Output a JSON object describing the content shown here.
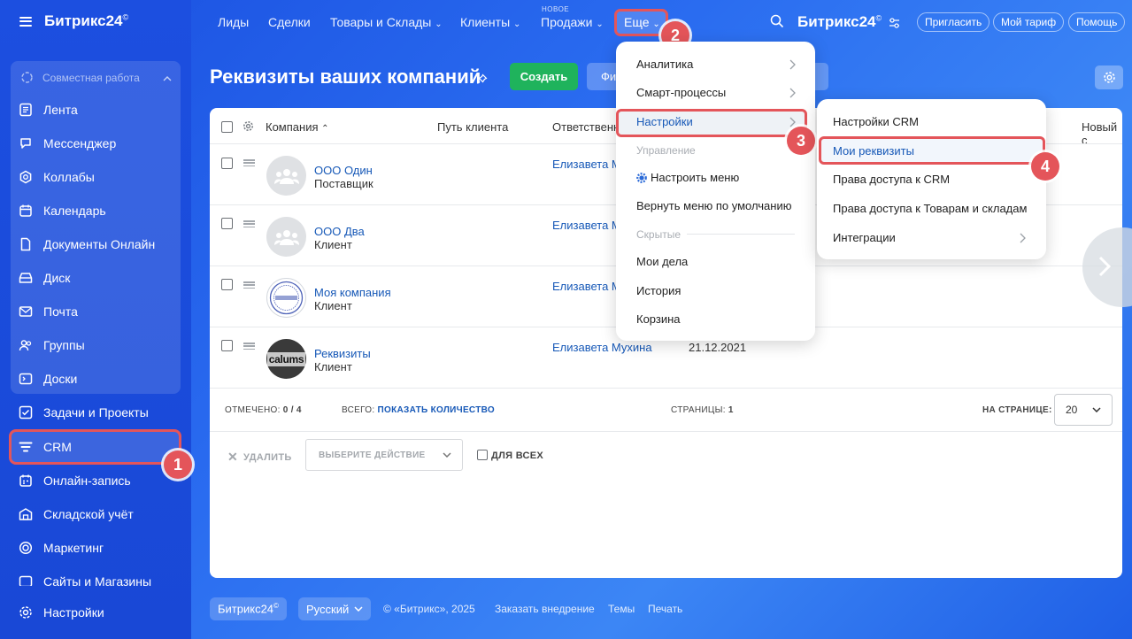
{
  "brand": {
    "name": "Битрикс24",
    "mark": "©"
  },
  "sidebar": {
    "group_title": "Совместная работа",
    "items": [
      {
        "label": "Лента",
        "icon": "feed-icon"
      },
      {
        "label": "Мессенджер",
        "icon": "messenger-icon"
      },
      {
        "label": "Коллабы",
        "icon": "collab-icon"
      },
      {
        "label": "Календарь",
        "icon": "calendar-icon"
      },
      {
        "label": "Документы Онлайн",
        "icon": "documents-icon"
      },
      {
        "label": "Диск",
        "icon": "disk-icon"
      },
      {
        "label": "Почта",
        "icon": "mail-icon"
      },
      {
        "label": "Группы",
        "icon": "groups-icon"
      },
      {
        "label": "Доски",
        "icon": "boards-icon"
      },
      {
        "label": "Задачи и Проекты",
        "icon": "tasks-icon"
      },
      {
        "label": "CRM",
        "icon": "crm-icon"
      },
      {
        "label": "Онлайн-запись",
        "icon": "booking-icon"
      },
      {
        "label": "Складской учёт",
        "icon": "warehouse-icon"
      },
      {
        "label": "Маркетинг",
        "icon": "marketing-icon"
      },
      {
        "label": "Сайты и Магазины",
        "icon": "sites-icon"
      },
      {
        "label": "Настройки",
        "icon": "settings-icon"
      }
    ]
  },
  "topnav": {
    "items": [
      "Лиды",
      "Сделки",
      "Товары и Склады",
      "Клиенты",
      "Продажи",
      "Еще"
    ],
    "new_label": "НОВОЕ",
    "invite": "Пригласить",
    "tariff": "Мой тариф",
    "help": "Помощь"
  },
  "page": {
    "title": "Реквизиты ваших компаний",
    "create": "Создать",
    "filter": "Фи"
  },
  "table": {
    "headers": {
      "company": "Компания",
      "path": "Путь клиента",
      "responsible": "Ответственный",
      "new": "Новый с"
    },
    "rows": [
      {
        "name": "ООО Один",
        "type": "Поставщик",
        "responsible": "Елизавета М",
        "date": ""
      },
      {
        "name": "ООО Два",
        "type": "Клиент",
        "responsible": "Елизавета М",
        "date": ""
      },
      {
        "name": "Моя компания",
        "type": "Клиент",
        "responsible": "Елизавета М",
        "date": ""
      },
      {
        "name": "Реквизиты",
        "type": "Клиент",
        "responsible": "Елизавета Мухина",
        "date": "21.12.2021",
        "logo_text": "calums"
      }
    ],
    "footer": {
      "checked_label": "ОТМЕЧЕНО:",
      "checked_value": "0 / 4",
      "total_label": "ВСЕГО:",
      "total_link": "ПОКАЗАТЬ КОЛИЧЕСТВО",
      "pages_label": "СТРАНИЦЫ:",
      "pages_value": "1",
      "per_page_label": "НА СТРАНИЦЕ:",
      "per_page_value": "20"
    },
    "actions": {
      "delete": "УДАЛИТЬ",
      "select_action": "ВЫБЕРИТЕ ДЕЙСТВИЕ",
      "for_all": "ДЛЯ ВСЕХ"
    }
  },
  "menu_more": {
    "analytics": "Аналитика",
    "smart": "Смарт-процессы",
    "settings": "Настройки",
    "management": "Управление",
    "configure": "Настроить меню",
    "reset": "Вернуть меню по умолчанию",
    "hidden": "Скрытые",
    "my_tasks": "Мои дела",
    "history": "История",
    "trash": "Корзина"
  },
  "menu_settings": {
    "crm_settings": "Настройки CRM",
    "my_requisites": "Мои реквизиты",
    "crm_access": "Права доступа к CRM",
    "goods_access": "Права доступа к Товарам и складам",
    "integrations": "Интеграции"
  },
  "badges": [
    "1",
    "2",
    "3",
    "4"
  ],
  "footer": {
    "brand": "Битрикс24",
    "lang": "Русский",
    "copyright": "© «Битрикс», 2025",
    "order": "Заказать внедрение",
    "themes": "Темы",
    "print": "Печать"
  },
  "colors": {
    "accent": "#1f56e0",
    "highlight": "#e4555a",
    "create": "#1fb35c",
    "link": "#1658b7"
  }
}
